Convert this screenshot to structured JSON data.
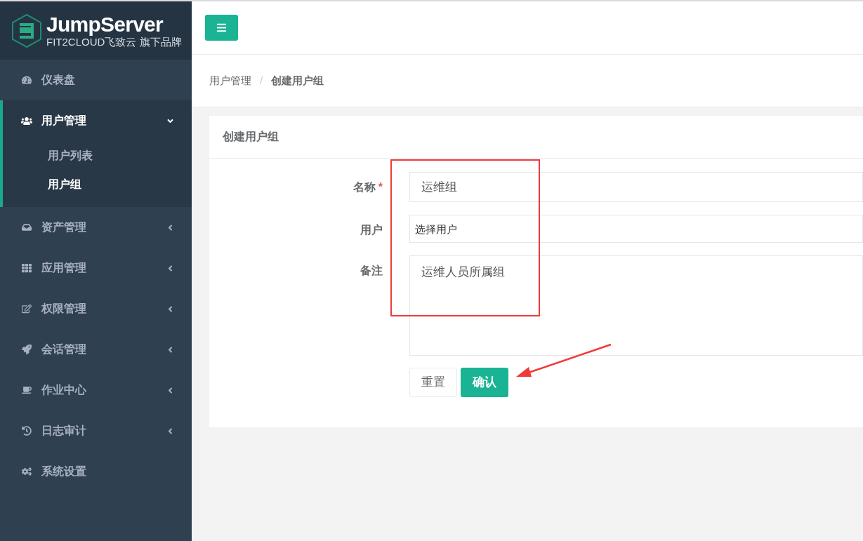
{
  "logo": {
    "title": "JumpServer",
    "subtitle": "FIT2CLOUD飞致云 旗下品牌"
  },
  "sidebar": {
    "items": [
      {
        "label": "仪表盘",
        "kind": "link"
      },
      {
        "label": "用户管理",
        "kind": "group",
        "expanded": true,
        "children": [
          {
            "label": "用户列表",
            "selected": false
          },
          {
            "label": "用户组",
            "selected": true
          }
        ]
      },
      {
        "label": "资产管理",
        "kind": "group",
        "expanded": false
      },
      {
        "label": "应用管理",
        "kind": "group",
        "expanded": false
      },
      {
        "label": "权限管理",
        "kind": "group",
        "expanded": false
      },
      {
        "label": "会话管理",
        "kind": "group",
        "expanded": false
      },
      {
        "label": "作业中心",
        "kind": "group",
        "expanded": false
      },
      {
        "label": "日志审计",
        "kind": "group",
        "expanded": false
      },
      {
        "label": "系统设置",
        "kind": "link"
      }
    ]
  },
  "breadcrumb": {
    "items": [
      "用户管理",
      "创建用户组"
    ],
    "separator": "/"
  },
  "card": {
    "title": "创建用户组",
    "fields": [
      {
        "label": "名称",
        "required_mark": "*",
        "kind": "input",
        "value": "运维组"
      },
      {
        "label": "用户",
        "kind": "select",
        "placeholder": "选择用户"
      },
      {
        "label": "备注",
        "kind": "textarea",
        "value": "运维人员所属组"
      }
    ],
    "buttons": [
      {
        "label": "重置",
        "kind": "default"
      },
      {
        "label": "确认",
        "kind": "primary"
      }
    ]
  }
}
